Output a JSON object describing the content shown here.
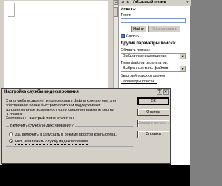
{
  "task_pane": {
    "nav": "◄ ►",
    "title": "Обычный поиск",
    "search_heading": "Искать:",
    "text_label": "Текст:",
    "text_value": "",
    "find_button": "Найти",
    "restore_button": "Восстановить",
    "tips_link": "Советы...",
    "other_heading": "Другие параметры поиска:",
    "scope_label": "Область поиска:",
    "scope_value": "Выбранные размещения",
    "filetypes_label": "Типы файлов результатов:",
    "filetypes_value": "Выбранные типы файлов",
    "fast_search_label": "Быстрый поиск отключен",
    "fast_search_link": "Параметры поиска..."
  },
  "dialog": {
    "title": "Настройка службы индексирования",
    "help_glyph": "?",
    "close_glyph": "×",
    "description": "Эта служба позволяет индексировать файлы компьютера для обеспечения более быстрого поиска и поддерживает дополнительные возможности для сведения нажмите кнопку \"Справка\".",
    "status_label": "Состояние:",
    "status_value": "выстрый поиск отключен",
    "group_legend": "Включить службу индексирования?",
    "option_yes": "Да, включить в запускать в режиме простоя компьютера.",
    "option_no": "Нет, невключить службу индексирования.",
    "selected_option": "no",
    "ok_button": "ОК",
    "cancel_button": "Отмена",
    "advanced_button": "Дополнительно...",
    "help_button": "Справка"
  }
}
